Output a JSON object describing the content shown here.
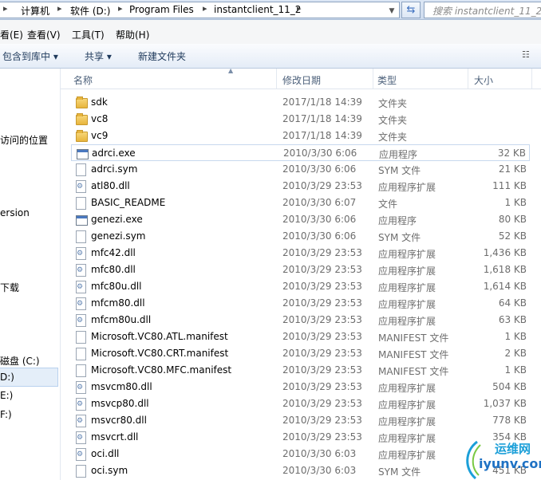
{
  "address": {
    "crumbs": [
      "计算机",
      "软件 (D:)",
      "Program Files",
      "instantclient_11_2"
    ],
    "search_placeholder": "搜索 instantclient_11_2"
  },
  "menu": [
    "看(E)",
    "查看(V)",
    "工具(T)",
    "帮助(H)"
  ],
  "toolbar": {
    "include_library": "包含到库中 ▾",
    "share": "共享 ▾",
    "new_folder": "新建文件夹"
  },
  "nav": {
    "items": [
      "访问的位置",
      "ersion",
      "下载",
      "磁盘 (C:)",
      "D:)",
      "E:)",
      "F:)"
    ]
  },
  "columns": {
    "name": "名称",
    "date": "修改日期",
    "type": "类型",
    "size": "大小"
  },
  "files": [
    {
      "name": "sdk",
      "date": "2017/1/18 14:39",
      "type": "文件夹",
      "size": "",
      "icon": "folder-icon"
    },
    {
      "name": "vc8",
      "date": "2017/1/18 14:39",
      "type": "文件夹",
      "size": "",
      "icon": "folder-icon"
    },
    {
      "name": "vc9",
      "date": "2017/1/18 14:39",
      "type": "文件夹",
      "size": "",
      "icon": "folder-icon"
    },
    {
      "name": "adrci.exe",
      "date": "2010/3/30 6:06",
      "type": "应用程序",
      "size": "32 KB",
      "icon": "exe-icon"
    },
    {
      "name": "adrci.sym",
      "date": "2010/3/30 6:06",
      "type": "SYM 文件",
      "size": "21 KB",
      "icon": "file-icon"
    },
    {
      "name": "atl80.dll",
      "date": "2010/3/29 23:53",
      "type": "应用程序扩展",
      "size": "111 KB",
      "icon": "dll-icon"
    },
    {
      "name": "BASIC_README",
      "date": "2010/3/30 6:07",
      "type": "文件",
      "size": "1 KB",
      "icon": "file-icon"
    },
    {
      "name": "genezi.exe",
      "date": "2010/3/30 6:06",
      "type": "应用程序",
      "size": "80 KB",
      "icon": "exe-icon"
    },
    {
      "name": "genezi.sym",
      "date": "2010/3/30 6:06",
      "type": "SYM 文件",
      "size": "52 KB",
      "icon": "file-icon"
    },
    {
      "name": "mfc42.dll",
      "date": "2010/3/29 23:53",
      "type": "应用程序扩展",
      "size": "1,436 KB",
      "icon": "dll-icon"
    },
    {
      "name": "mfc80.dll",
      "date": "2010/3/29 23:53",
      "type": "应用程序扩展",
      "size": "1,618 KB",
      "icon": "dll-icon"
    },
    {
      "name": "mfc80u.dll",
      "date": "2010/3/29 23:53",
      "type": "应用程序扩展",
      "size": "1,614 KB",
      "icon": "dll-icon"
    },
    {
      "name": "mfcm80.dll",
      "date": "2010/3/29 23:53",
      "type": "应用程序扩展",
      "size": "64 KB",
      "icon": "dll-icon"
    },
    {
      "name": "mfcm80u.dll",
      "date": "2010/3/29 23:53",
      "type": "应用程序扩展",
      "size": "63 KB",
      "icon": "dll-icon"
    },
    {
      "name": "Microsoft.VC80.ATL.manifest",
      "date": "2010/3/29 23:53",
      "type": "MANIFEST 文件",
      "size": "1 KB",
      "icon": "file-icon"
    },
    {
      "name": "Microsoft.VC80.CRT.manifest",
      "date": "2010/3/29 23:53",
      "type": "MANIFEST 文件",
      "size": "2 KB",
      "icon": "file-icon"
    },
    {
      "name": "Microsoft.VC80.MFC.manifest",
      "date": "2010/3/29 23:53",
      "type": "MANIFEST 文件",
      "size": "1 KB",
      "icon": "file-icon"
    },
    {
      "name": "msvcm80.dll",
      "date": "2010/3/29 23:53",
      "type": "应用程序扩展",
      "size": "504 KB",
      "icon": "dll-icon"
    },
    {
      "name": "msvcp80.dll",
      "date": "2010/3/29 23:53",
      "type": "应用程序扩展",
      "size": "1,037 KB",
      "icon": "dll-icon"
    },
    {
      "name": "msvcr80.dll",
      "date": "2010/3/29 23:53",
      "type": "应用程序扩展",
      "size": "778 KB",
      "icon": "dll-icon"
    },
    {
      "name": "msvcrt.dll",
      "date": "2010/3/29 23:53",
      "type": "应用程序扩展",
      "size": "354 KB",
      "icon": "dll-icon"
    },
    {
      "name": "oci.dll",
      "date": "2010/3/30 6:03",
      "type": "应用程序扩展",
      "size": "",
      "icon": "dll-icon"
    },
    {
      "name": "oci.sym",
      "date": "2010/3/30 6:03",
      "type": "SYM 文件",
      "size": "451 KB",
      "icon": "file-icon"
    }
  ],
  "watermark": {
    "cn": "运维网",
    "en": "iyunv.com"
  }
}
